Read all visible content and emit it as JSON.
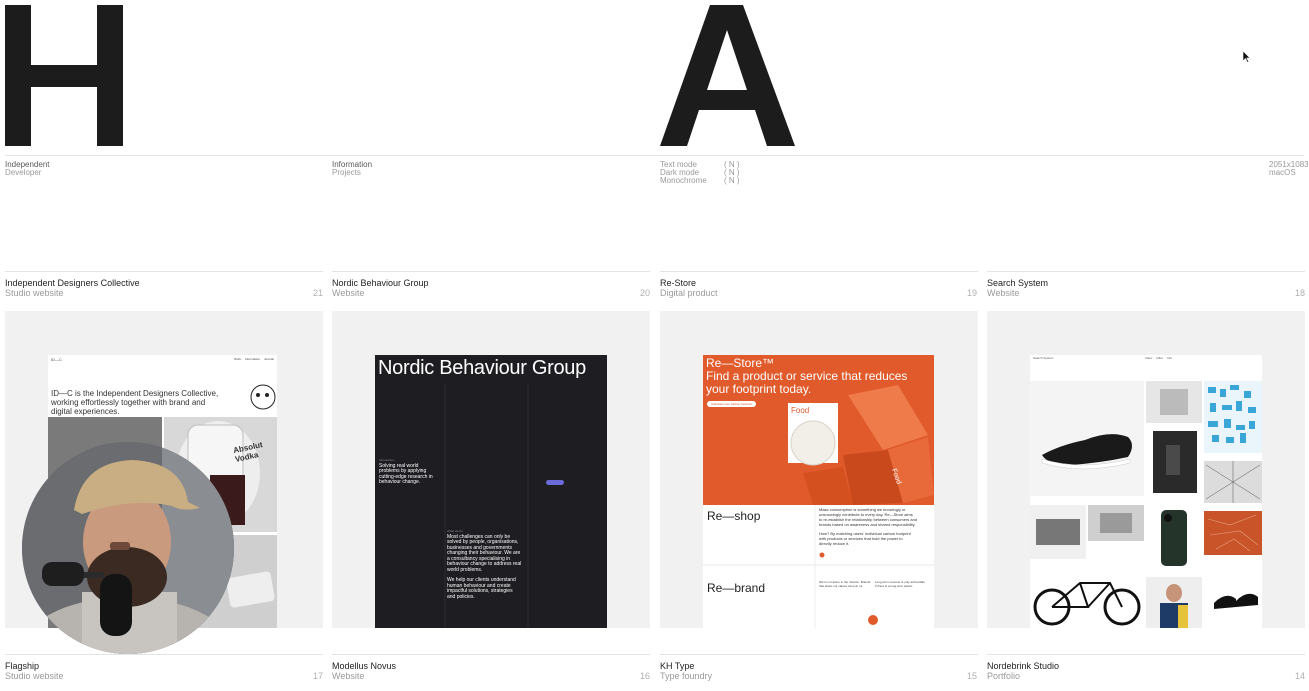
{
  "hero": {
    "letter_left": "H",
    "letter_right": "A"
  },
  "info": {
    "col1": {
      "line1": "Independent",
      "line2": "Developer"
    },
    "col2": {
      "line1": "Information",
      "line2": "Projects"
    },
    "modes": [
      {
        "label": "Text mode",
        "value": "( N )"
      },
      {
        "label": "Dark mode",
        "value": "( N )"
      },
      {
        "label": "Monochrome",
        "value": "( N )"
      }
    ],
    "screen": {
      "resolution": "2051x1083",
      "os": "macOS"
    }
  },
  "projects_top": [
    {
      "title": "Independent Designers Collective",
      "type": "Studio website",
      "number": "21"
    },
    {
      "title": "Nordic Behaviour Group",
      "type": "Website",
      "number": "20"
    },
    {
      "title": "Re-Store",
      "type": "Digital product",
      "number": "19"
    },
    {
      "title": "Search System",
      "type": "Website",
      "number": "18"
    }
  ],
  "projects_bottom": [
    {
      "title": "Flagship",
      "type": "Studio website",
      "number": "17"
    },
    {
      "title": "Modellus Novus",
      "type": "Website",
      "number": "16"
    },
    {
      "title": "KH Type",
      "type": "Type foundry",
      "number": "15"
    },
    {
      "title": "Nordebrink Studio",
      "type": "Portfolio",
      "number": "14"
    }
  ],
  "previews": {
    "idc": {
      "logo": "ID—C",
      "nav": [
        "Work",
        "Information",
        "Journal"
      ],
      "headline_1": "ID—C is the Independent Designers Collective,",
      "headline_2": "working effortlessly together with brand and",
      "headline_3": "digital experiences.",
      "bottle_text_1": "Absolut",
      "bottle_text_2": "Vodka"
    },
    "nbg": {
      "title": "Nordic Behaviour Group",
      "p1_label": "Introduction",
      "p1_1": "Solving real world",
      "p1_2": "problems by applying",
      "p1_3": "cutting-edge research in",
      "p1_4": "behaviour change.",
      "p2_label": "What we do",
      "p2_1": "Most challenges can only be",
      "p2_2": "solved by people, organisations,",
      "p2_3": "businesses and governments",
      "p2_4": "changing their behaviour. We are",
      "p2_5": "a consultancy specialising in",
      "p2_6": "behaviour change to address real",
      "p2_7": "world problems.",
      "p3_1": "We help our clients understand",
      "p3_2": "human behaviour and create",
      "p3_3": "impactful solutions, strategies",
      "p3_4": "and policies."
    },
    "restore": {
      "brand": "Re—Store",
      "nav": [
        "Re—shop",
        "Re—brand",
        "About"
      ],
      "headline_1": "Re—Store™",
      "headline_2": "Find a product or service that reduces",
      "headline_3": "your footprint today.",
      "cta": "Calculate your carbon footprint",
      "food_label": "Food",
      "box_label": "Food",
      "section1": "Re—shop",
      "s1_text_1": "Mass consumption is something we knowingly or",
      "s1_text_2": "unknowingly contribute to every day. Re—Store aims",
      "s1_text_3": "to re-establish the relationship between consumers and",
      "s1_text_4": "brands based on awareness and shared responsibility.",
      "s1_text_5": "How? By matching users' individual carbon footprint",
      "s1_text_6": "with products or services that hold the power to",
      "s1_text_7": "directly reduce it.",
      "section2": "Re—brand",
      "s2_text_1": "We're not alone in the mission. Brands",
      "s2_text_2": "that share our values can join us.",
      "s2_text_3": "Long-term revenue is only achievable",
      "s2_text_4": "if there is a long-term planet."
    },
    "search": {
      "logo": "Search System",
      "nav": [
        "Index",
        "Filter",
        "Info"
      ]
    }
  },
  "colors": {
    "hero_letter": "#1c1c1c",
    "nbg_bg": "#1d1d22",
    "restore_orange": "#e05a2b",
    "restore_cta_bg": "#ffffff",
    "nbg_pill": "#6b6bd9",
    "card_bg": "#f1f1f1"
  }
}
